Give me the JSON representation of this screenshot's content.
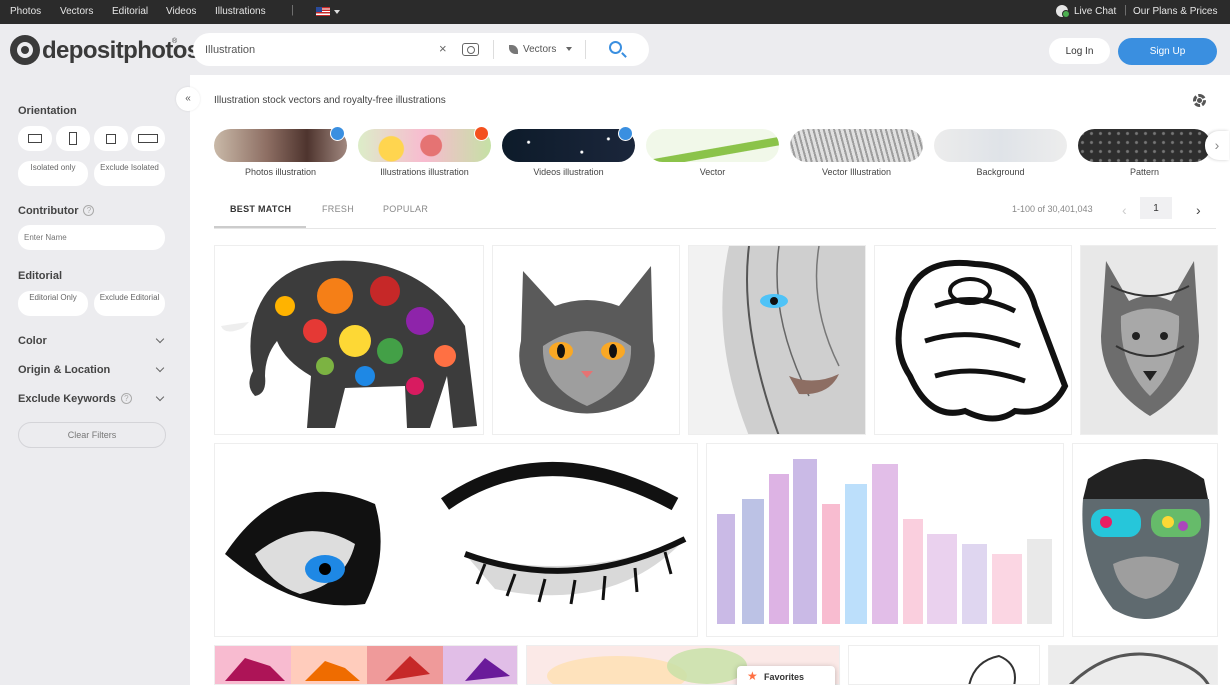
{
  "topbar": {
    "nav": [
      "Photos",
      "Vectors",
      "Editorial",
      "Videos",
      "Illustrations"
    ],
    "live_chat": "Live Chat",
    "plans": "Our Plans & Prices"
  },
  "header": {
    "logo": "depositphotos",
    "search_value": "Illustration",
    "clear_glyph": "×",
    "content_type": "Vectors",
    "login": "Log In",
    "signup": "Sign Up",
    "accent_color": "#3a8fe0"
  },
  "sidebar": {
    "collapse_glyph": "«",
    "orientation_title": "Orientation",
    "isolated_only": "Isolated only",
    "exclude_isolated": "Exclude Isolated",
    "contributor_title": "Contributor",
    "contributor_placeholder": "Enter Name",
    "editorial_title": "Editorial",
    "editorial_only": "Editorial Only",
    "exclude_editorial": "Exclude Editorial",
    "color": "Color",
    "origin": "Origin & Location",
    "exclude_keywords": "Exclude Keywords",
    "help_glyph": "?",
    "clear_filters": "Clear Filters"
  },
  "main": {
    "heading": "Illustration stock vectors and royalty-free illustrations",
    "chips": [
      {
        "label": "Photos illustration"
      },
      {
        "label": "Illustrations illustration"
      },
      {
        "label": "Videos illustration"
      },
      {
        "label": "Vector"
      },
      {
        "label": "Vector Illustration"
      },
      {
        "label": "Background"
      },
      {
        "label": "Pattern"
      }
    ],
    "chip_next": "›",
    "tabs": [
      "BEST MATCH",
      "FRESH",
      "POPULAR"
    ],
    "results": "1-100 of 30,401,043",
    "page": "1",
    "prev": "‹",
    "next": "›",
    "favorites": "Favorites",
    "star": "★"
  }
}
